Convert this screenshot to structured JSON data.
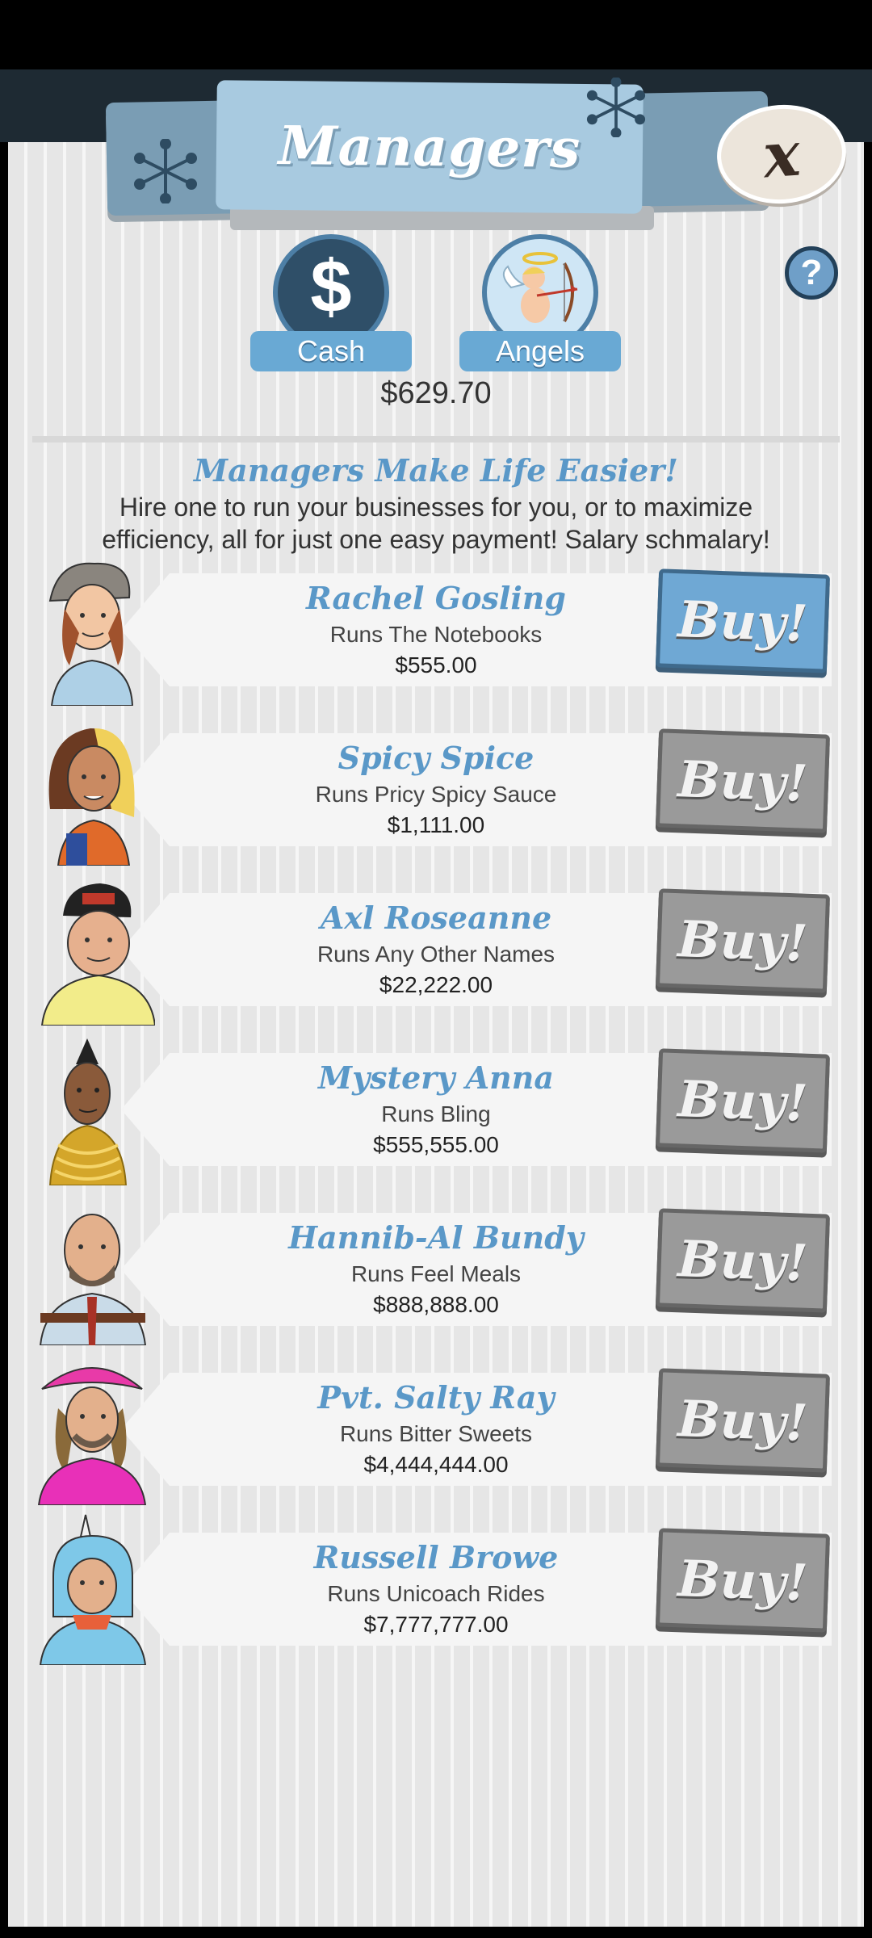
{
  "header": {
    "title": "Managers",
    "close_label": "x",
    "help_label": "?"
  },
  "currency": {
    "cash_label": "Cash",
    "cash_symbol": "$",
    "angels_label": "Angels",
    "amount": "$629.70"
  },
  "intro": {
    "title": "Managers Make Life Easier!",
    "text": "Hire one to run your businesses for you, or to maximize efficiency, all for just one easy payment! Salary schmalary!"
  },
  "managers": [
    {
      "name": "Rachel Gosling",
      "runs": "Runs The Notebooks",
      "price": "$555.00",
      "buy_label": "Buy!",
      "affordable": true
    },
    {
      "name": "Spicy Spice",
      "runs": "Runs Pricy Spicy Sauce",
      "price": "$1,111.00",
      "buy_label": "Buy!",
      "affordable": false
    },
    {
      "name": "Axl Roseanne",
      "runs": "Runs Any Other Names",
      "price": "$22,222.00",
      "buy_label": "Buy!",
      "affordable": false
    },
    {
      "name": "Mystery Anna",
      "runs": "Runs Bling",
      "price": "$555,555.00",
      "buy_label": "Buy!",
      "affordable": false
    },
    {
      "name": "Hannib-Al Bundy",
      "runs": "Runs Feel Meals",
      "price": "$888,888.00",
      "buy_label": "Buy!",
      "affordable": false
    },
    {
      "name": "Pvt. Salty Ray",
      "runs": "Runs Bitter Sweets",
      "price": "$4,444,444.00",
      "buy_label": "Buy!",
      "affordable": false
    },
    {
      "name": "Russell Browe",
      "runs": "Runs Unicoach Rides",
      "price": "$7,777,777.00",
      "buy_label": "Buy!",
      "affordable": false
    }
  ],
  "colors": {
    "accent_blue": "#5a98c8",
    "buy_active": "#6fa8d4",
    "buy_disabled": "#9a9a9a",
    "panel_bg": "#ebebeb"
  }
}
